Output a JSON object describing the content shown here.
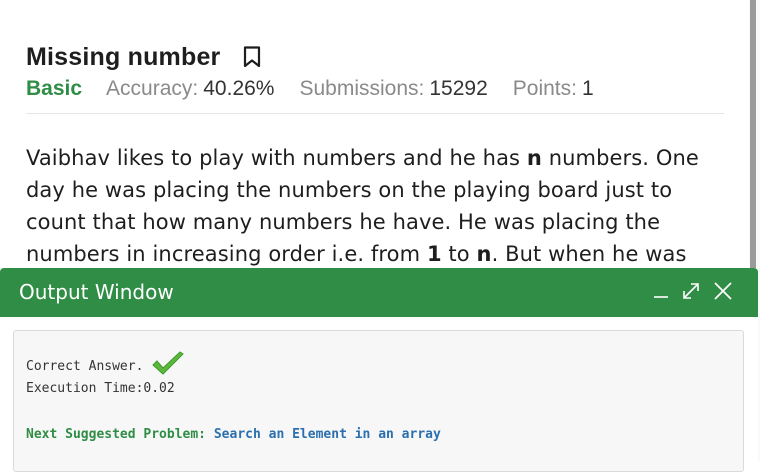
{
  "problem": {
    "title": "Missing number",
    "difficulty": "Basic",
    "accuracy_label": "Accuracy:",
    "accuracy_value": "40.26%",
    "submissions_label": "Submissions:",
    "submissions_value": "15292",
    "points_label": "Points:",
    "points_value": "1",
    "description": {
      "l1_a": "Vaibhav likes to play with numbers and he has ",
      "l1_b": "n",
      "l1_c": " numbers. One",
      "l2": "day he was placing the numbers on the playing board just to",
      "l3": "count that how many numbers he have. He was placing the",
      "l4_a": "numbers in increasing order i.e. from ",
      "l4_b": "1",
      "l4_c": " to ",
      "l4_d": "n",
      "l4_e": ". But when he was"
    }
  },
  "output_window": {
    "title": "Output Window",
    "controls": [
      "minimize-icon",
      "expand-icon",
      "close-icon"
    ],
    "result": "Correct Answer.",
    "execution_time": "Execution Time:0.02",
    "next_label": "Next Suggested Problem:",
    "next_link": "Search an Element in an array"
  },
  "colors": {
    "accent_green": "#2f8d46",
    "link_blue": "#2b6fae"
  }
}
